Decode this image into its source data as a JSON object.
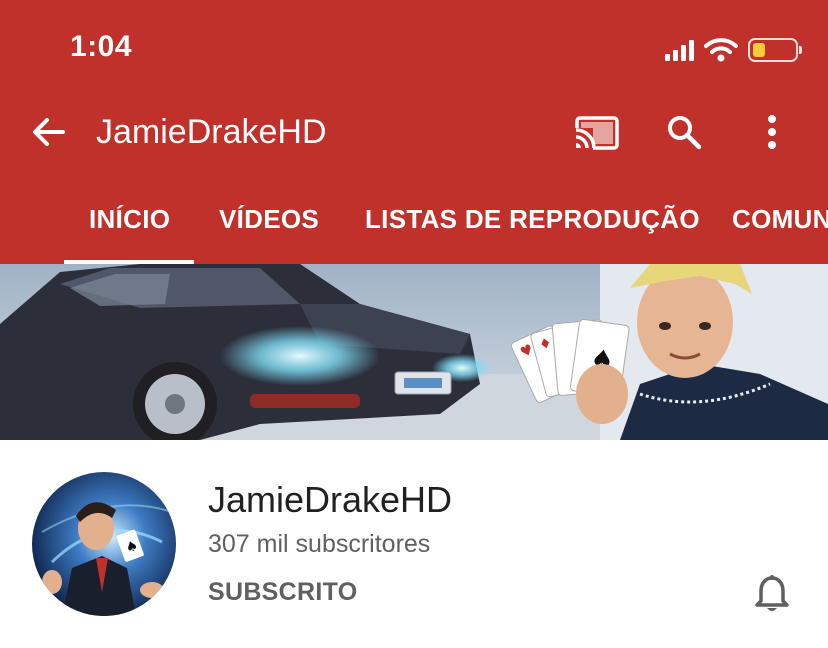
{
  "status_bar": {
    "time": "1:04",
    "icons": [
      "signal-icon",
      "wifi-icon",
      "battery-icon"
    ],
    "battery_level": 0.25,
    "battery_color": "#f6cc3a"
  },
  "app_bar": {
    "title": "JamieDrakeHD",
    "background": "#c0312b",
    "icons": [
      "back-arrow-icon",
      "cast-icon",
      "search-icon",
      "more-vert-icon"
    ]
  },
  "tabs": [
    {
      "label": "INÍCIO",
      "selected": true
    },
    {
      "label": "VÍDEOS",
      "selected": false
    },
    {
      "label": "LISTAS DE REPRODUÇÃO",
      "selected": false
    },
    {
      "label": "COMUN",
      "selected": false
    }
  ],
  "channel": {
    "name": "JamieDrakeHD",
    "subscribers": "307 mil subscritores",
    "subscribe_label": "SUBSCRITO",
    "notification_icon": "bell-icon"
  }
}
